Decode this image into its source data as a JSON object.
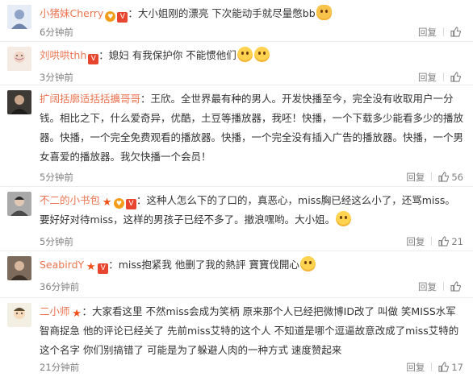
{
  "actions": {
    "reply": "回复"
  },
  "comments": [
    {
      "user": "小猪妹Cherry",
      "badges": [
        "orange",
        "red"
      ],
      "text": "大小姐刚的漂亮 下次能动手就尽量憋bb",
      "emoji_after": "cat",
      "time": "6分钟前",
      "likes": ""
    },
    {
      "user": "刘哄哄thh",
      "badges": [
        "red"
      ],
      "text": "媳妇 有我保护你 不能惯他们",
      "emoji_after": "smile2",
      "time": "3分钟前",
      "likes": ""
    },
    {
      "user": "扩阔括廓适括括擴哥哥",
      "badges": [],
      "text": "王欣。全世界最有种的男人。开发快播至今，完全没有收取用户一分钱。相比之下，什么爱奇异，优酷，土豆等播放器，我呸！快播，一个下载多少能看多少的播放器。快播，一个完全免费观看的播放器。快播，一个完全没有插入广告的播放器。快播，一个男女喜爱的播放器。我欠快播一个会员！",
      "emoji_after": "",
      "time": "5分钟前",
      "likes": "56"
    },
    {
      "user": "不二的小书包",
      "badges": [
        "star",
        "orange",
        "red"
      ],
      "text": "这种人怎么下的了口的，真恶心，miss胸已经这么小了，还骂miss。要好好对待miss，这样的男孩子已经不多了。撤浪嘿哟。大小姐。",
      "emoji_after": "smile",
      "time": "5分钟前",
      "likes": "21"
    },
    {
      "user": "SeabirdY",
      "badges": [
        "star",
        "red"
      ],
      "text": "miss抱紧我 他删了我的熱評 寶寶伐開心",
      "emoji_after": "cry",
      "time": "36分钟前",
      "likes": ""
    },
    {
      "user": "二小师",
      "badges": [
        "star"
      ],
      "text": "大家看这里 不然miss会成为笑柄 原来那个人已经把微博ID改了 叫做 笑MISS水军智商捉急 他的评论已经关了 先前miss艾特的这个人 不知道是哪个逗逼故意改成了miss艾特的这个名字 你们别搞错了 可能是为了躲避人肉的一种方式 速度赞起来",
      "emoji_after": "",
      "time": "21分钟前",
      "likes": "17"
    }
  ]
}
